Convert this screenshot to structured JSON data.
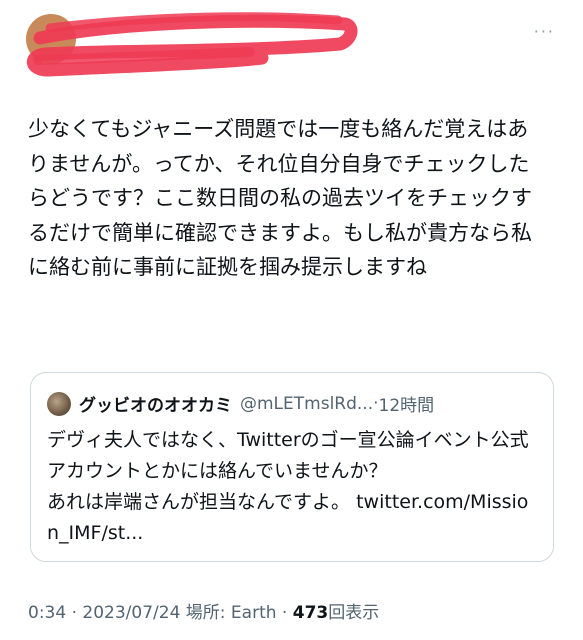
{
  "tweet": {
    "more_icon": "···",
    "body": "少なくてもジャニーズ問題では一度も絡んだ覚えはありませんが。ってか、それ位自分自身でチェックしたらどうです？ここ数日間の私の過去ツイをチェックするだけで簡単に確認できますよ。もし私が貴方なら私に絡む前に事前に証拠を掴み提示しますね",
    "time": "0:34",
    "separator1": " · ",
    "date": "2023/07/24",
    "location": " 場所: Earth",
    "separator2": " · ",
    "views_count": "473",
    "views_label": "回表示"
  },
  "quote": {
    "name": "グッビオのオオカミ",
    "handle": "@mLETmslRd...",
    "dot": "·",
    "time": "12時間",
    "text": "デヴィ夫人ではなく、Twitterのゴー宣公論イベント公式アカウントとかには絡んでいませんか？",
    "text2": "あれは岸端さんが担当なんですよ。",
    "link": "twitter.com/Mission_IMF/st..."
  },
  "colors": {
    "scribble": "#ef3b55",
    "text": "#0f1419",
    "secondary": "#536471",
    "border": "#cfd9de"
  }
}
